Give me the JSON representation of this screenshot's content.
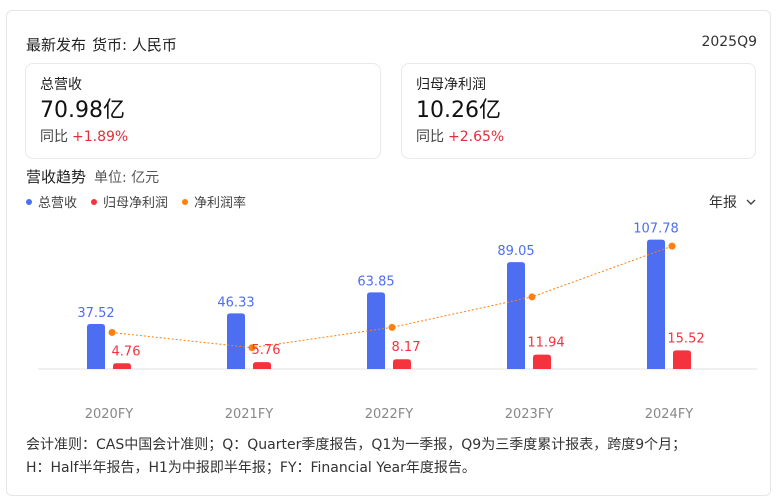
{
  "header": {
    "section_label": "最新发布",
    "currency": "货币: 人民币",
    "period_code": "2025Q9"
  },
  "cards": [
    {
      "label": "总营收",
      "value": "70.98亿",
      "yoy_label": "同比",
      "yoy_value": "+1.89%"
    },
    {
      "label": "归母净利润",
      "value": "10.26亿",
      "yoy_label": "同比",
      "yoy_value": "+2.65%"
    }
  ],
  "trend": {
    "title": "营收趋势",
    "unit": "单位: 亿元",
    "period_selector": "年报",
    "chevron_icon": "chevron-down-icon"
  },
  "legend": [
    {
      "name": "总营收",
      "color": "#4e6ef2"
    },
    {
      "name": "归母净利润",
      "color": "#f5333f"
    },
    {
      "name": "净利润率",
      "color": "#ff7f0e"
    }
  ],
  "chart_data": {
    "type": "bar",
    "categories": [
      "2020FY",
      "2021FY",
      "2022FY",
      "2023FY",
      "2024FY"
    ],
    "series": [
      {
        "name": "总营收",
        "type": "bar",
        "color": "#4e6ef2",
        "values": [
          37.52,
          46.33,
          63.85,
          89.05,
          107.78
        ]
      },
      {
        "name": "归母净利润",
        "type": "bar",
        "color": "#f5333f",
        "values": [
          4.76,
          5.76,
          8.17,
          11.94,
          15.52
        ]
      },
      {
        "name": "净利润率",
        "type": "line",
        "color": "#ff7f0e",
        "values": [
          12.7,
          12.4,
          12.8,
          13.4,
          14.4
        ]
      }
    ],
    "xlabel": "",
    "ylabel": "",
    "ylim": [
      0,
      110
    ],
    "grid": false,
    "legend_position": "top-left"
  },
  "footnote": {
    "line1": "会计准则：CAS中国会计准则；Q：Quarter季度报告，Q1为一季报，Q9为三季度累计报表，跨度9个月；",
    "line2": "H：Half半年报告，H1为中报即半年报；FY：Financial Year年度报告。"
  }
}
